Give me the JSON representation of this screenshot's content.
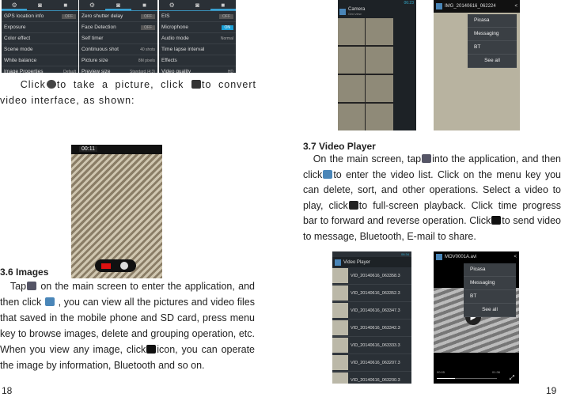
{
  "settings_screens": [
    {
      "tab_active": 0,
      "rows": [
        [
          "GPS location info",
          "OFF"
        ],
        [
          "Exposure",
          ""
        ],
        [
          "Color effect",
          ""
        ],
        [
          "Scene mode",
          ""
        ],
        [
          "White balance",
          ""
        ],
        [
          "Image Properties",
          "Default"
        ]
      ]
    },
    {
      "tab_active": 1,
      "rows": [
        [
          "Zero shutter delay",
          "OFF"
        ],
        [
          "Face Detection",
          "OFF"
        ],
        [
          "Self timer",
          ""
        ],
        [
          "Continuous shot",
          "40 shots"
        ],
        [
          "Picture size",
          "8M pixels"
        ],
        [
          "Preview size",
          "Standard (4:3)"
        ]
      ]
    },
    {
      "tab_active": 2,
      "rows": [
        [
          "EIS",
          "OFF"
        ],
        [
          "Microphone",
          "ON"
        ],
        [
          "Audio mode",
          "Normal"
        ],
        [
          "Time lapse interval",
          ""
        ],
        [
          "Effects",
          ""
        ],
        [
          "Video quality",
          "HD"
        ]
      ]
    }
  ],
  "left": {
    "intro": {
      "a": "Click",
      "b": "to take a picture, click",
      "c": "to convert video interface, as shown:"
    },
    "camera": {
      "timer": "00:11"
    },
    "heading": "3.6 Images",
    "para": {
      "a": "Tap",
      "b": "on the main screen to enter the application, and then click",
      "c": ", you can view all the pictures and video files that saved in the mobile phone and SD card, press menu key to browse images, delete and grouping operation, etc. When you view any image, click",
      "d": "icon, you can operate the image by information, Bluetooth and so on."
    },
    "page_number": "18"
  },
  "right": {
    "gallery": {
      "album": "Camera",
      "sub": "Grid view",
      "time": "06:23"
    },
    "image_view": {
      "title": "IMG_20140616_062224",
      "menu": [
        "Picasa",
        "Messaging",
        "BT",
        "See all"
      ]
    },
    "heading": "3.7 Video Player",
    "para": {
      "a": "On the main screen, tap",
      "b": "into the application, and then click",
      "c": "to enter the video list. Click on the menu key you can delete, sort, and other operations. Select a video to play, click",
      "d": "to full-screen playback. Click time progress bar to forward and reverse operation. Click",
      "e": "to send video to message, Bluetooth, E-mail to share."
    },
    "video_list": {
      "title": "Video Player",
      "time": "06:34",
      "items": [
        "VID_20140616_063358.3",
        "VID_20140616_063352.3",
        "VID_20140616_063347.3",
        "VID_20140616_063342.3",
        "VID_20140616_063333.3",
        "VID_20140616_063207.3",
        "VID_20140616_063200.3"
      ]
    },
    "video_view": {
      "title": "MOV0001A.avi",
      "menu": [
        "Picasa",
        "Messaging",
        "BT",
        "See all"
      ],
      "elapsed": "00:05",
      "total": "01:36",
      "progress": 0.3
    },
    "page_number": "19"
  }
}
